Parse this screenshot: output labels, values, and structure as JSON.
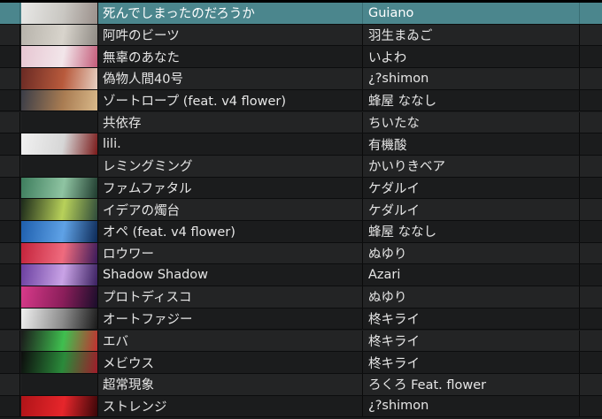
{
  "tracks": [
    {
      "title": "死んでしまったのだろうか",
      "artist": "Guiano",
      "art_colors": [
        "#e8e8e6",
        "#c9c7c2",
        "#9a8f8a"
      ]
    },
    {
      "title": "阿吽のビーツ",
      "artist": "羽生まゐご",
      "art_colors": [
        "#b7b3ab",
        "#d8d4cc",
        "#8f8a84"
      ]
    },
    {
      "title": "無辜のあなた",
      "artist": "いよわ",
      "art_colors": [
        "#e7c6d2",
        "#f2e6ea",
        "#c45c7a"
      ]
    },
    {
      "title": "偽物人間40号",
      "artist": "¿?shimon",
      "art_colors": [
        "#6a2a24",
        "#b85a3c",
        "#e6d0c2"
      ]
    },
    {
      "title": "ゾートロープ (feat. v4 flower)",
      "artist": "蜂屋 ななし",
      "art_colors": [
        "#3a3d48",
        "#a97c52",
        "#d9b98a"
      ]
    },
    {
      "title": "共依存",
      "artist": "ちいたな",
      "art_colors": [
        "#1b1c1d",
        "#1b1c1d",
        "#1b1c1d"
      ]
    },
    {
      "title": "lili.",
      "artist": "有機酸",
      "art_colors": [
        "#f1f1f1",
        "#d6d6d6",
        "#7a1a1a"
      ]
    },
    {
      "title": "レミングミング",
      "artist": "かいりきベア",
      "art_colors": [
        "#1b1c1d",
        "#1b1c1d",
        "#1b1c1d"
      ]
    },
    {
      "title": "ファムファタル",
      "artist": "ケダルイ",
      "art_colors": [
        "#3d7d5d",
        "#8fc4a2",
        "#1f3b2e"
      ]
    },
    {
      "title": "イデアの燭台",
      "artist": "ケダルイ",
      "art_colors": [
        "#1c2a1a",
        "#b8d15a",
        "#2f4b3a"
      ]
    },
    {
      "title": "オペ (feat. v4 flower)",
      "artist": "蜂屋 ななし",
      "art_colors": [
        "#1e5fae",
        "#5fa2e6",
        "#0d2a57"
      ]
    },
    {
      "title": "ロウワー",
      "artist": "ぬゆり",
      "art_colors": [
        "#c4233b",
        "#ef6b7e",
        "#3a1a5a"
      ]
    },
    {
      "title": "Shadow Shadow",
      "artist": "Azari",
      "art_colors": [
        "#6a3fa0",
        "#c9a3e6",
        "#3a2060"
      ]
    },
    {
      "title": "プロトディスコ",
      "artist": "ぬゆり",
      "art_colors": [
        "#d83a8a",
        "#8a1e5a",
        "#1a0d2a"
      ]
    },
    {
      "title": "オートファジー",
      "artist": "柊キライ",
      "art_colors": [
        "#f0f0f0",
        "#8a8a8a",
        "#1a1a1a"
      ]
    },
    {
      "title": "エバ",
      "artist": "柊キライ",
      "art_colors": [
        "#1a1a1a",
        "#3fbf4f",
        "#c43030"
      ]
    },
    {
      "title": "メビウス",
      "artist": "柊キライ",
      "art_colors": [
        "#0d0d0d",
        "#2a8a3a",
        "#a01c2a"
      ]
    },
    {
      "title": "超常現象",
      "artist": "ろくろ Feat. flower",
      "art_colors": [
        "#1b1c1d",
        "#1b1c1d",
        "#1b1c1d"
      ]
    },
    {
      "title": "ストレンジ",
      "artist": "¿?shimon",
      "art_colors": [
        "#b01418",
        "#e6262b",
        "#3a0608"
      ]
    }
  ],
  "selected_index": 0
}
